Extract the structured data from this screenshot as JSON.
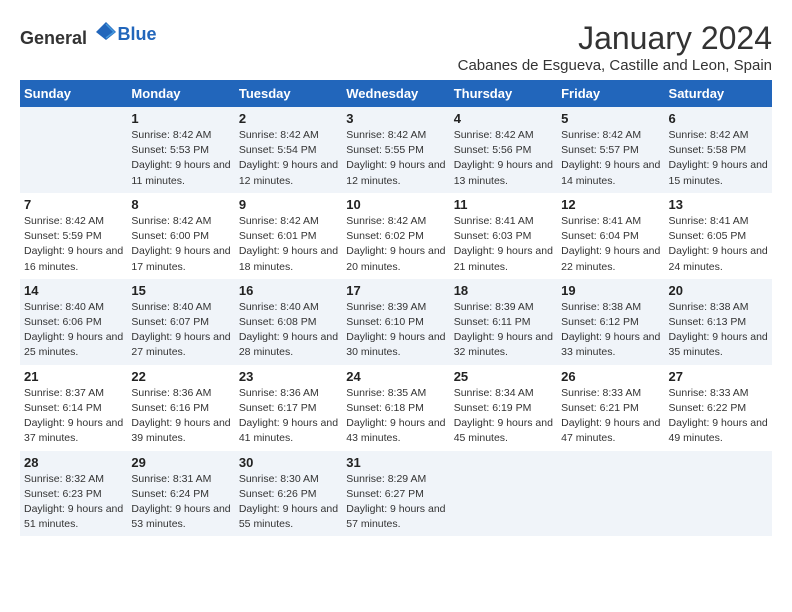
{
  "header": {
    "logo_general": "General",
    "logo_blue": "Blue",
    "month_year": "January 2024",
    "location": "Cabanes de Esgueva, Castille and Leon, Spain"
  },
  "days_of_week": [
    "Sunday",
    "Monday",
    "Tuesday",
    "Wednesday",
    "Thursday",
    "Friday",
    "Saturday"
  ],
  "weeks": [
    [
      {
        "day": "",
        "sunrise": "",
        "sunset": "",
        "daylight": ""
      },
      {
        "day": "1",
        "sunrise": "Sunrise: 8:42 AM",
        "sunset": "Sunset: 5:53 PM",
        "daylight": "Daylight: 9 hours and 11 minutes."
      },
      {
        "day": "2",
        "sunrise": "Sunrise: 8:42 AM",
        "sunset": "Sunset: 5:54 PM",
        "daylight": "Daylight: 9 hours and 12 minutes."
      },
      {
        "day": "3",
        "sunrise": "Sunrise: 8:42 AM",
        "sunset": "Sunset: 5:55 PM",
        "daylight": "Daylight: 9 hours and 12 minutes."
      },
      {
        "day": "4",
        "sunrise": "Sunrise: 8:42 AM",
        "sunset": "Sunset: 5:56 PM",
        "daylight": "Daylight: 9 hours and 13 minutes."
      },
      {
        "day": "5",
        "sunrise": "Sunrise: 8:42 AM",
        "sunset": "Sunset: 5:57 PM",
        "daylight": "Daylight: 9 hours and 14 minutes."
      },
      {
        "day": "6",
        "sunrise": "Sunrise: 8:42 AM",
        "sunset": "Sunset: 5:58 PM",
        "daylight": "Daylight: 9 hours and 15 minutes."
      }
    ],
    [
      {
        "day": "7",
        "sunrise": "Sunrise: 8:42 AM",
        "sunset": "Sunset: 5:59 PM",
        "daylight": "Daylight: 9 hours and 16 minutes."
      },
      {
        "day": "8",
        "sunrise": "Sunrise: 8:42 AM",
        "sunset": "Sunset: 6:00 PM",
        "daylight": "Daylight: 9 hours and 17 minutes."
      },
      {
        "day": "9",
        "sunrise": "Sunrise: 8:42 AM",
        "sunset": "Sunset: 6:01 PM",
        "daylight": "Daylight: 9 hours and 18 minutes."
      },
      {
        "day": "10",
        "sunrise": "Sunrise: 8:42 AM",
        "sunset": "Sunset: 6:02 PM",
        "daylight": "Daylight: 9 hours and 20 minutes."
      },
      {
        "day": "11",
        "sunrise": "Sunrise: 8:41 AM",
        "sunset": "Sunset: 6:03 PM",
        "daylight": "Daylight: 9 hours and 21 minutes."
      },
      {
        "day": "12",
        "sunrise": "Sunrise: 8:41 AM",
        "sunset": "Sunset: 6:04 PM",
        "daylight": "Daylight: 9 hours and 22 minutes."
      },
      {
        "day": "13",
        "sunrise": "Sunrise: 8:41 AM",
        "sunset": "Sunset: 6:05 PM",
        "daylight": "Daylight: 9 hours and 24 minutes."
      }
    ],
    [
      {
        "day": "14",
        "sunrise": "Sunrise: 8:40 AM",
        "sunset": "Sunset: 6:06 PM",
        "daylight": "Daylight: 9 hours and 25 minutes."
      },
      {
        "day": "15",
        "sunrise": "Sunrise: 8:40 AM",
        "sunset": "Sunset: 6:07 PM",
        "daylight": "Daylight: 9 hours and 27 minutes."
      },
      {
        "day": "16",
        "sunrise": "Sunrise: 8:40 AM",
        "sunset": "Sunset: 6:08 PM",
        "daylight": "Daylight: 9 hours and 28 minutes."
      },
      {
        "day": "17",
        "sunrise": "Sunrise: 8:39 AM",
        "sunset": "Sunset: 6:10 PM",
        "daylight": "Daylight: 9 hours and 30 minutes."
      },
      {
        "day": "18",
        "sunrise": "Sunrise: 8:39 AM",
        "sunset": "Sunset: 6:11 PM",
        "daylight": "Daylight: 9 hours and 32 minutes."
      },
      {
        "day": "19",
        "sunrise": "Sunrise: 8:38 AM",
        "sunset": "Sunset: 6:12 PM",
        "daylight": "Daylight: 9 hours and 33 minutes."
      },
      {
        "day": "20",
        "sunrise": "Sunrise: 8:38 AM",
        "sunset": "Sunset: 6:13 PM",
        "daylight": "Daylight: 9 hours and 35 minutes."
      }
    ],
    [
      {
        "day": "21",
        "sunrise": "Sunrise: 8:37 AM",
        "sunset": "Sunset: 6:14 PM",
        "daylight": "Daylight: 9 hours and 37 minutes."
      },
      {
        "day": "22",
        "sunrise": "Sunrise: 8:36 AM",
        "sunset": "Sunset: 6:16 PM",
        "daylight": "Daylight: 9 hours and 39 minutes."
      },
      {
        "day": "23",
        "sunrise": "Sunrise: 8:36 AM",
        "sunset": "Sunset: 6:17 PM",
        "daylight": "Daylight: 9 hours and 41 minutes."
      },
      {
        "day": "24",
        "sunrise": "Sunrise: 8:35 AM",
        "sunset": "Sunset: 6:18 PM",
        "daylight": "Daylight: 9 hours and 43 minutes."
      },
      {
        "day": "25",
        "sunrise": "Sunrise: 8:34 AM",
        "sunset": "Sunset: 6:19 PM",
        "daylight": "Daylight: 9 hours and 45 minutes."
      },
      {
        "day": "26",
        "sunrise": "Sunrise: 8:33 AM",
        "sunset": "Sunset: 6:21 PM",
        "daylight": "Daylight: 9 hours and 47 minutes."
      },
      {
        "day": "27",
        "sunrise": "Sunrise: 8:33 AM",
        "sunset": "Sunset: 6:22 PM",
        "daylight": "Daylight: 9 hours and 49 minutes."
      }
    ],
    [
      {
        "day": "28",
        "sunrise": "Sunrise: 8:32 AM",
        "sunset": "Sunset: 6:23 PM",
        "daylight": "Daylight: 9 hours and 51 minutes."
      },
      {
        "day": "29",
        "sunrise": "Sunrise: 8:31 AM",
        "sunset": "Sunset: 6:24 PM",
        "daylight": "Daylight: 9 hours and 53 minutes."
      },
      {
        "day": "30",
        "sunrise": "Sunrise: 8:30 AM",
        "sunset": "Sunset: 6:26 PM",
        "daylight": "Daylight: 9 hours and 55 minutes."
      },
      {
        "day": "31",
        "sunrise": "Sunrise: 8:29 AM",
        "sunset": "Sunset: 6:27 PM",
        "daylight": "Daylight: 9 hours and 57 minutes."
      },
      {
        "day": "",
        "sunrise": "",
        "sunset": "",
        "daylight": ""
      },
      {
        "day": "",
        "sunrise": "",
        "sunset": "",
        "daylight": ""
      },
      {
        "day": "",
        "sunrise": "",
        "sunset": "",
        "daylight": ""
      }
    ]
  ]
}
